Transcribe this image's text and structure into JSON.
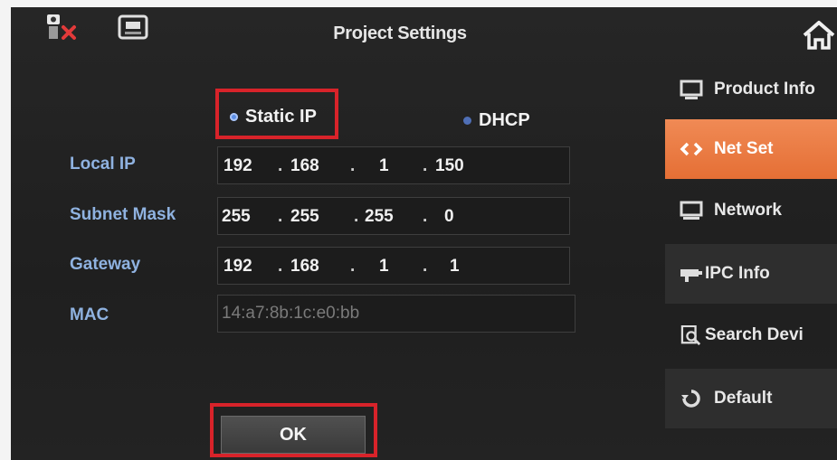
{
  "header": {
    "title": "Project Settings",
    "icons": [
      "network-alarm-icon",
      "sd-card-icon",
      "home-icon"
    ]
  },
  "mode": {
    "static_label": "Static IP",
    "dhcp_label": "DHCP",
    "selected": "Static IP"
  },
  "form": {
    "local_ip": {
      "label": "Local IP",
      "octets": [
        "192",
        "168",
        "1",
        "150"
      ]
    },
    "subnet_mask": {
      "label": "Subnet Mask",
      "octets": [
        "255",
        "255",
        "255",
        "0"
      ]
    },
    "gateway": {
      "label": "Gateway",
      "octets": [
        "192",
        "168",
        "1",
        "1"
      ]
    },
    "mac": {
      "label": "MAC",
      "value": "14:a7:8b:1c:e0:bb"
    },
    "separator": "."
  },
  "sidebar": {
    "items": [
      {
        "label": "Product Info",
        "icon": "monitor-icon"
      },
      {
        "label": "Net Set",
        "icon": "code-brackets-icon",
        "active": true
      },
      {
        "label": "Network",
        "icon": "screen-icon"
      },
      {
        "label": "IPC Info",
        "icon": "camera-icon"
      },
      {
        "label": "Search Devi",
        "icon": "search-device-icon"
      },
      {
        "label": "Default",
        "icon": "recycle-icon"
      }
    ]
  },
  "ok_label": "OK",
  "colors": {
    "accent": "#e56f35",
    "highlight_box": "#d8232a",
    "label": "#8fb2e0"
  }
}
